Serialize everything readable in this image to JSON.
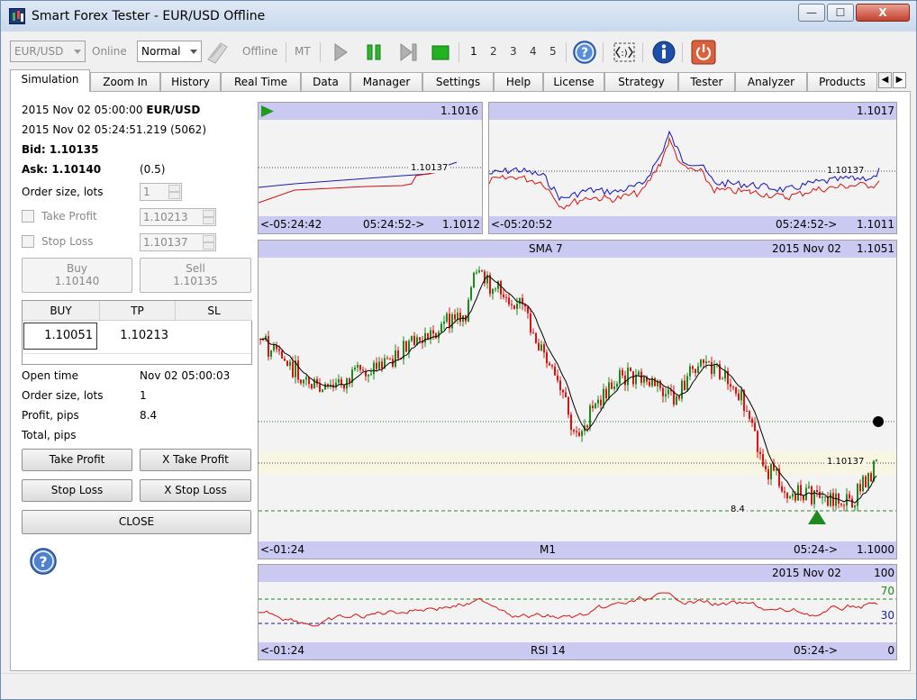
{
  "window": {
    "title": "Smart Forex Tester - EUR/USD Offline",
    "min": "—",
    "max": "☐",
    "close": "X"
  },
  "toolbar": {
    "symbol": "EUR/USD",
    "online": "Online",
    "mode": "Normal",
    "offline": "Offline",
    "mt": "MT",
    "speeds": [
      "1",
      "2",
      "3",
      "4",
      "5"
    ]
  },
  "tabs": [
    "Simulation",
    "Zoom In",
    "History",
    "Real Time",
    "Data",
    "Manager",
    "Settings",
    "Help",
    "License",
    "Strategy",
    "Tester",
    "Analyzer",
    "Products"
  ],
  "left": {
    "bar_time": "2015 Nov 02 05:00:00",
    "symbol": "EUR/USD",
    "tick_time": "2015 Nov 02 05:24:51.219 (5062)",
    "bid_label": "Bid:",
    "bid": "1.10135",
    "ask_label": "Ask:",
    "ask": "1.10140",
    "spread": "(0.5)",
    "order_size_label": "Order size, lots",
    "order_size": "1",
    "tp_label": "Take Profit",
    "tp_value": "1.10213",
    "sl_label": "Stop Loss",
    "sl_value": "1.10137",
    "buy_label": "Buy",
    "buy_price": "1.10140",
    "sell_label": "Sell",
    "sell_price": "1.10135",
    "grid_headers": [
      "BUY",
      "TP",
      "SL"
    ],
    "grid_row": [
      "1.10051",
      "1.10213",
      ""
    ],
    "open_time_label": "Open time",
    "open_time": "Nov 02 05:00:03",
    "order_size2_label": "Order size, lots",
    "order_size2": "1",
    "profit_label": "Profit, pips",
    "profit": "8.4",
    "total_label": "Total, pips",
    "btn_tp": "Take Profit",
    "btn_xtp": "X Take Profit",
    "btn_sl": "Stop Loss",
    "btn_xsl": "X Stop Loss",
    "btn_close": "CLOSE"
  },
  "tick_chart1": {
    "top_right": "1.1016",
    "level": "1.10137",
    "footer_left": "<-05:24:42",
    "footer_mid": "05:24:52->",
    "footer_right": "1.1012"
  },
  "tick_chart2": {
    "top_right": "1.1017",
    "level": "1.10137",
    "footer_left": "<-05:20:52",
    "footer_mid": "05:24:52->",
    "footer_right": "1.1011"
  },
  "main_chart": {
    "indicator": "SMA 7",
    "date": "2015 Nov 02",
    "top_right": "1.1051",
    "level": "1.10137",
    "profit_tag": "8.4",
    "footer_left": "<-01:24",
    "timeframe": "M1",
    "footer_mid": "05:24->",
    "footer_right": "1.1000"
  },
  "rsi_chart": {
    "date": "2015 Nov 02",
    "top_right": "100",
    "upper": "70",
    "lower": "30",
    "footer_left": "<-01:24",
    "indicator": "RSI 14",
    "footer_mid": "05:24->",
    "footer_right": "0"
  },
  "colors": {
    "panel_bar": "#c9c9f1",
    "bull": "#1a8a1a",
    "bear": "#e01010",
    "blue_line": "#1010c0",
    "red_line": "#dd1111"
  }
}
